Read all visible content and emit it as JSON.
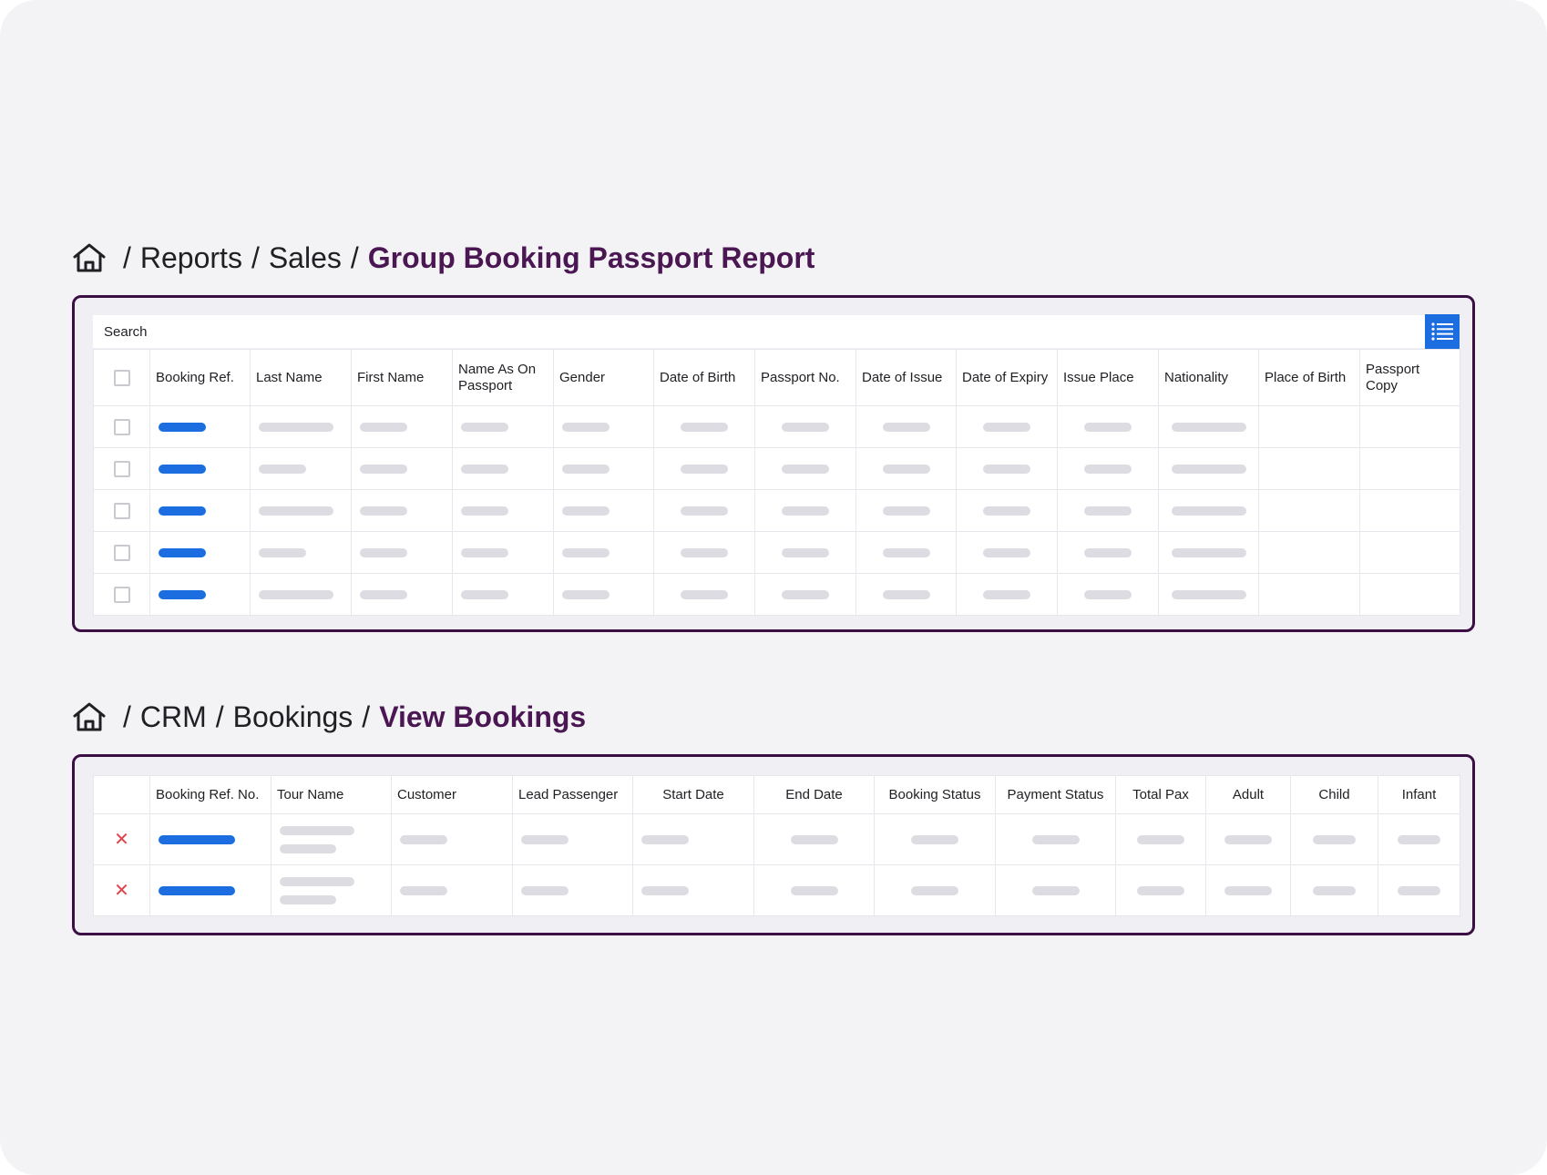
{
  "passport_report": {
    "breadcrumb": {
      "home_icon": "home-icon",
      "items": [
        "Reports",
        "Sales"
      ],
      "current": "Group Booking Passport Report"
    },
    "search": {
      "placeholder": "Search"
    },
    "list_button_icon": "list-icon",
    "columns": [
      "Booking Ref.",
      "Last Name",
      "First Name",
      "Name As On Passport",
      "Gender",
      "Date of Birth",
      "Passport No.",
      "Date of Issue",
      "Date of Expiry",
      "Issue Place",
      "Nationality",
      "Place of Birth",
      "Passport Copy"
    ],
    "row_count": 5
  },
  "view_bookings": {
    "breadcrumb": {
      "home_icon": "home-icon",
      "items": [
        "CRM",
        "Bookings"
      ],
      "current": "View Bookings"
    },
    "columns": [
      "Booking Ref. No.",
      "Tour Name",
      "Customer",
      "Lead Passenger",
      "Start Date",
      "End Date",
      "Booking Status",
      "Payment Status",
      "Total Pax",
      "Adult",
      "Child",
      "Infant"
    ],
    "row_count": 2,
    "row_action_icon": "close-icon"
  },
  "colors": {
    "accent": "#1b6de0",
    "frame": "#3b0f44",
    "current_crumb": "#4a1752",
    "delete": "#e0454f",
    "placeholder_bar": "#dcdce2"
  }
}
